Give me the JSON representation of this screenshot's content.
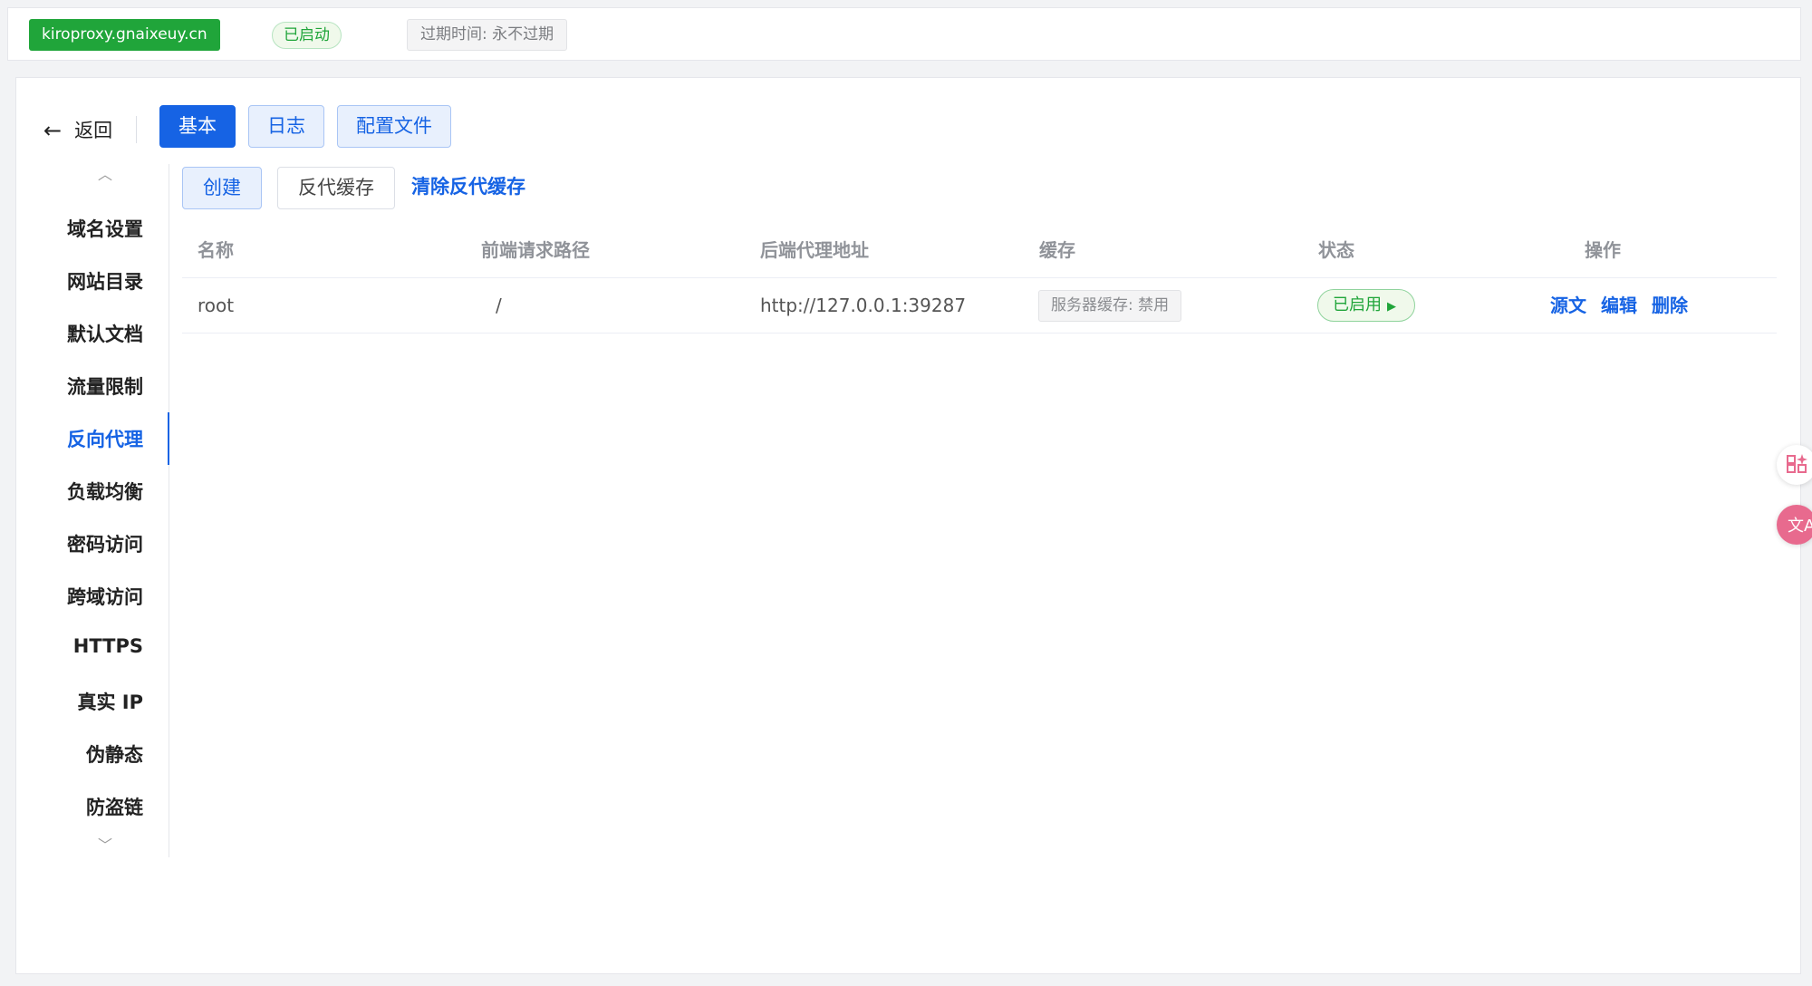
{
  "topbar": {
    "site_name": "kiroproxy.gnaixeuy.cn",
    "status": "已启动",
    "expire": "过期时间: 永不过期"
  },
  "nav": {
    "back_label": "返回",
    "tabs": [
      {
        "label": "基本",
        "active": true
      },
      {
        "label": "日志",
        "active": false
      },
      {
        "label": "配置文件",
        "active": false
      }
    ]
  },
  "sidebar": {
    "items": [
      {
        "label": "域名设置"
      },
      {
        "label": "网站目录"
      },
      {
        "label": "默认文档"
      },
      {
        "label": "流量限制"
      },
      {
        "label": "反向代理",
        "active": true
      },
      {
        "label": "负载均衡"
      },
      {
        "label": "密码访问"
      },
      {
        "label": "跨域访问"
      },
      {
        "label": "HTTPS"
      },
      {
        "label": "真实 IP"
      },
      {
        "label": "伪静态"
      },
      {
        "label": "防盗链"
      }
    ]
  },
  "toolbar": {
    "create": "创建",
    "cache": "反代缓存",
    "clear_cache": "清除反代缓存"
  },
  "table": {
    "headers": [
      "名称",
      "前端请求路径",
      "后端代理地址",
      "缓存",
      "状态",
      "操作"
    ],
    "rows": [
      {
        "name": "root",
        "path": "/",
        "backend": "http://127.0.0.1:39287",
        "cache": "服务器缓存: 禁用",
        "state": "已启用",
        "ops": [
          "源文",
          "编辑",
          "删除"
        ]
      }
    ]
  },
  "colors": {
    "accent": "#1663e4",
    "success": "#20a53a"
  },
  "icons": [
    "arrow-left-icon",
    "chevron-up-icon",
    "chevron-down-icon",
    "caret-right-icon",
    "apps-icon",
    "translate-icon"
  ]
}
